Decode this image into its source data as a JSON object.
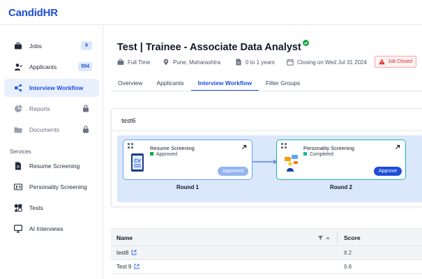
{
  "app": {
    "logo": "CandidHR"
  },
  "sidebar": {
    "items": [
      {
        "label": "Jobs",
        "badge": "9",
        "icon": "briefcase-icon"
      },
      {
        "label": "Applicants",
        "badge": "554",
        "icon": "user-check-icon"
      },
      {
        "label": "Interview Workflow",
        "icon": "workflow-icon",
        "active": true
      },
      {
        "label": "Reports",
        "icon": "pie-chart-icon",
        "locked": true
      },
      {
        "label": "Documents",
        "icon": "folder-icon",
        "locked": true
      }
    ],
    "services_title": "Services",
    "services": [
      {
        "label": "Resume Screening",
        "icon": "document-icon"
      },
      {
        "label": "Personality Screening",
        "icon": "id-card-icon"
      },
      {
        "label": "Tests",
        "icon": "shapes-icon"
      },
      {
        "label": "AI Interviews",
        "icon": "monitor-icon"
      }
    ]
  },
  "job": {
    "title": "Test | Trainee - Associate Data Analyst",
    "type": "Full Time",
    "location": "Pune, Maharashtra",
    "experience": "0 to 1 years",
    "closing": "Closing on Wed Jul 31 2024",
    "status_badge": "Job Closed"
  },
  "tabs": [
    {
      "label": "Overview"
    },
    {
      "label": "Applicants"
    },
    {
      "label": "Interview Workflow",
      "active": true
    },
    {
      "label": "Filter Groups"
    }
  ],
  "workflow": {
    "name": "test6",
    "rounds": [
      {
        "title": "Resume Screening",
        "status": "Approved",
        "action": "Approved",
        "round_label": "Round 1"
      },
      {
        "title": "Personality Screening",
        "status": "Completed",
        "action": "Approve",
        "round_label": "Round 2"
      }
    ]
  },
  "table": {
    "columns": [
      "Name",
      "Score"
    ],
    "rows": [
      {
        "name": "test8",
        "score": "8.2"
      },
      {
        "name": "Test 9",
        "score": "9.8"
      }
    ]
  },
  "colors": {
    "accent": "#1d4ed8",
    "active_bg": "#e8f0fd",
    "canvas_bg": "#dbe8fb",
    "closed_red": "#dc2626",
    "success_green": "#16a34a",
    "teal_border": "#14b8a6"
  }
}
